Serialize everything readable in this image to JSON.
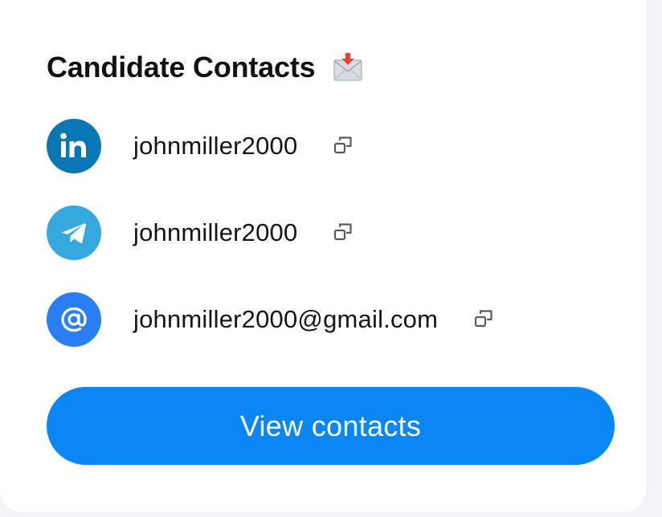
{
  "card": {
    "title": "Candidate Contacts",
    "title_icon": "envelope-with-arrow-icon"
  },
  "contacts": [
    {
      "network": "LinkedIn",
      "icon": "linkedin-icon",
      "value": "johnmiller2000",
      "color": "#0a77b5"
    },
    {
      "network": "Telegram",
      "icon": "telegram-icon",
      "value": "johnmiller2000",
      "color": "#35a8de"
    },
    {
      "network": "Email",
      "icon": "at-sign-icon",
      "value": "johnmiller2000@gmail.com",
      "color": "#2a7ff5"
    }
  ],
  "copy_icon": "copy-icon",
  "actions": {
    "view_contacts_label": "View contacts",
    "button_color": "#0a86f5"
  }
}
